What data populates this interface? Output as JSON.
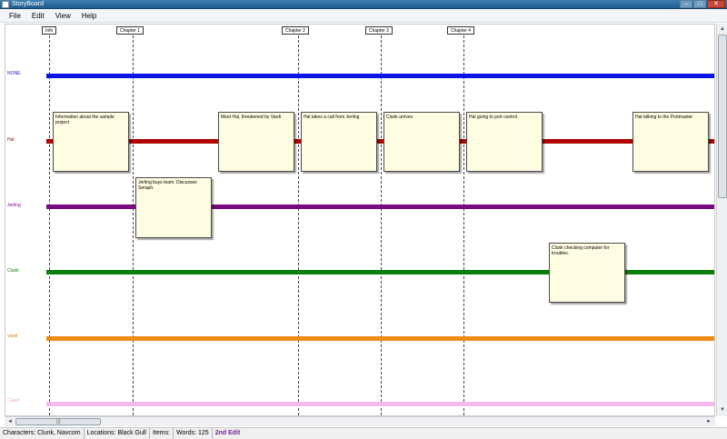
{
  "window": {
    "title": "StoryBoard",
    "buttons": {
      "minimize": "–",
      "maximize": "□",
      "close": "✕"
    }
  },
  "menu": [
    "File",
    "Edit",
    "View",
    "Help"
  ],
  "lanes": [
    {
      "label": "NONE",
      "color": "#0a14e6",
      "label_color": "#1a1acc"
    },
    {
      "label": "Hal",
      "color": "#b00000",
      "label_color": "#b00000"
    },
    {
      "label": "Jerling",
      "color": "#7a0a82",
      "label_color": "#7a0a82"
    },
    {
      "label": "Clunk",
      "color": "#0a7d0a",
      "label_color": "#0a7d0a"
    },
    {
      "label": "Vardi",
      "color": "#f08a14",
      "label_color": "#e07a00"
    },
    {
      "label": "Caled",
      "color": "#f7b8ee",
      "label_color": "#f0a6e4"
    }
  ],
  "chapters": [
    "Info",
    "Chapter 1",
    "Chapter 2",
    "Chapter 3",
    "Chapter 4"
  ],
  "notes": [
    {
      "text": "Information about the sample project",
      "lane": "Hal"
    },
    {
      "text": "Meet Hal, threatened by Vardi",
      "lane": "Hal"
    },
    {
      "text": "Hal takes a call from Jerling",
      "lane": "Hal"
    },
    {
      "text": "Clunk arrives",
      "lane": "Hal"
    },
    {
      "text": "Hal going to port control",
      "lane": "Hal"
    },
    {
      "text": "Hal talking to the Portmaster",
      "lane": "Hal"
    },
    {
      "text": "Jerling buys team.  Discusses Seraph.",
      "lane": "Jerling"
    },
    {
      "text": "Clunk checking computer for troubles.",
      "lane": "Clunk"
    }
  ],
  "scrollbars": {
    "up": "▲",
    "down": "▼",
    "left": "◄",
    "right": "►",
    "grip": "|||"
  },
  "status": {
    "characters": "Characters: Clunk, Navcom",
    "locations": "Locations: Black Gull",
    "items": "Items:",
    "words": "Words: 125",
    "edit": "2nd Edit"
  }
}
